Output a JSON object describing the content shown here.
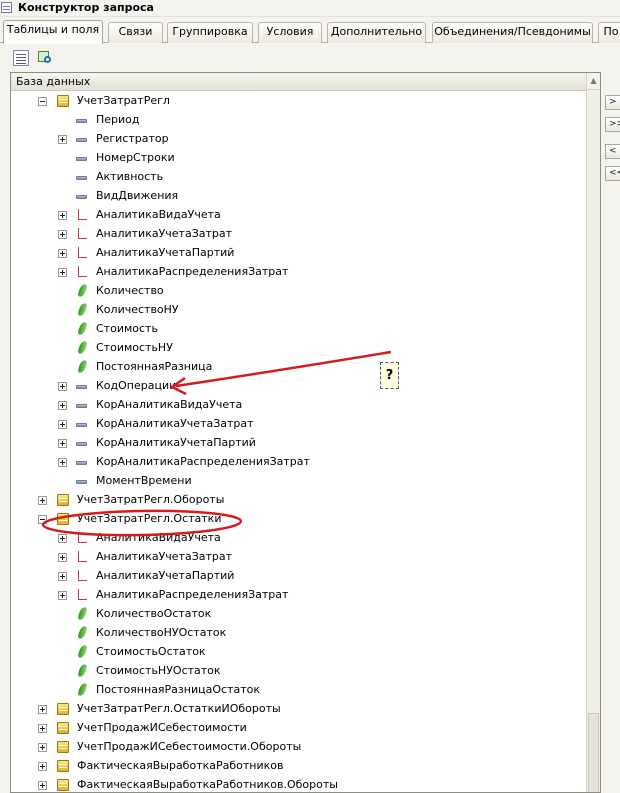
{
  "window": {
    "title": "Конструктор запроса"
  },
  "tabs": [
    {
      "label": "Таблицы и поля",
      "active": true
    },
    {
      "label": "Связи"
    },
    {
      "label": "Группировка"
    },
    {
      "label": "Условия"
    },
    {
      "label": "Дополнительно"
    },
    {
      "label": "Объединения/Псевдонимы"
    },
    {
      "label": "По"
    }
  ],
  "toolbar": {
    "buttons": [
      "list-icon",
      "query-wizard-icon"
    ]
  },
  "panel": {
    "header": "База данных"
  },
  "side_buttons": [
    ">",
    ">>",
    "<",
    "<<"
  ],
  "tree": [
    {
      "label": "УчетЗатратРегл",
      "kind": "table",
      "level": 0,
      "expander": "minus"
    },
    {
      "label": "Период",
      "kind": "attr",
      "level": 1,
      "expander": "none"
    },
    {
      "label": "Регистратор",
      "kind": "attr",
      "level": 1,
      "expander": "plus"
    },
    {
      "label": "НомерСтроки",
      "kind": "attr",
      "level": 1,
      "expander": "none"
    },
    {
      "label": "Активность",
      "kind": "attr",
      "level": 1,
      "expander": "none"
    },
    {
      "label": "ВидДвижения",
      "kind": "attr",
      "level": 1,
      "expander": "none"
    },
    {
      "label": "АналитикаВидаУчета",
      "kind": "dim",
      "level": 1,
      "expander": "plus"
    },
    {
      "label": "АналитикаУчетаЗатрат",
      "kind": "dim",
      "level": 1,
      "expander": "plus"
    },
    {
      "label": "АналитикаУчетаПартий",
      "kind": "dim",
      "level": 1,
      "expander": "plus"
    },
    {
      "label": "АналитикаРаспределенияЗатрат",
      "kind": "dim",
      "level": 1,
      "expander": "plus"
    },
    {
      "label": "Количество",
      "kind": "res",
      "level": 1,
      "expander": "none"
    },
    {
      "label": "КоличествоНУ",
      "kind": "res",
      "level": 1,
      "expander": "none"
    },
    {
      "label": "Стоимость",
      "kind": "res",
      "level": 1,
      "expander": "none"
    },
    {
      "label": "СтоимостьНУ",
      "kind": "res",
      "level": 1,
      "expander": "none"
    },
    {
      "label": "ПостояннаяРазница",
      "kind": "res",
      "level": 1,
      "expander": "none"
    },
    {
      "label": "КодОперации",
      "kind": "attr",
      "level": 1,
      "expander": "plus"
    },
    {
      "label": "КорАналитикаВидаУчета",
      "kind": "attr",
      "level": 1,
      "expander": "plus"
    },
    {
      "label": "КорАналитикаУчетаЗатрат",
      "kind": "attr",
      "level": 1,
      "expander": "plus"
    },
    {
      "label": "КорАналитикаУчетаПартий",
      "kind": "attr",
      "level": 1,
      "expander": "plus"
    },
    {
      "label": "КорАналитикаРаспределенияЗатрат",
      "kind": "attr",
      "level": 1,
      "expander": "plus"
    },
    {
      "label": "МоментВремени",
      "kind": "attr",
      "level": 1,
      "expander": "none"
    },
    {
      "label": "УчетЗатратРегл.Обороты",
      "kind": "table",
      "level": 0,
      "expander": "plus"
    },
    {
      "label": "УчетЗатратРегл.Остатки",
      "kind": "table",
      "level": 0,
      "expander": "minus"
    },
    {
      "label": "АналитикаВидаУчета",
      "kind": "dim",
      "level": 1,
      "expander": "plus"
    },
    {
      "label": "АналитикаУчетаЗатрат",
      "kind": "dim",
      "level": 1,
      "expander": "plus"
    },
    {
      "label": "АналитикаУчетаПартий",
      "kind": "dim",
      "level": 1,
      "expander": "plus"
    },
    {
      "label": "АналитикаРаспределенияЗатрат",
      "kind": "dim",
      "level": 1,
      "expander": "plus"
    },
    {
      "label": "КоличествоОстаток",
      "kind": "res",
      "level": 1,
      "expander": "none"
    },
    {
      "label": "КоличествоНУОстаток",
      "kind": "res",
      "level": 1,
      "expander": "none"
    },
    {
      "label": "СтоимостьОстаток",
      "kind": "res",
      "level": 1,
      "expander": "none"
    },
    {
      "label": "СтоимостьНУОстаток",
      "kind": "res",
      "level": 1,
      "expander": "none"
    },
    {
      "label": "ПостояннаяРазницаОстаток",
      "kind": "res",
      "level": 1,
      "expander": "none"
    },
    {
      "label": "УчетЗатратРегл.ОстаткиИОбороты",
      "kind": "table",
      "level": 0,
      "expander": "plus"
    },
    {
      "label": "УчетПродажИСебестоимости",
      "kind": "table",
      "level": 0,
      "expander": "plus"
    },
    {
      "label": "УчетПродажИСебестоимости.Обороты",
      "kind": "table",
      "level": 0,
      "expander": "plus"
    },
    {
      "label": "ФактическаяВыработкаРаботников",
      "kind": "table",
      "level": 0,
      "expander": "plus"
    },
    {
      "label": "ФактическаяВыработкаРаботников.Обороты",
      "kind": "table",
      "level": 0,
      "expander": "plus"
    }
  ],
  "annotation": {
    "question_mark": "?",
    "color": "#d41c1c"
  }
}
